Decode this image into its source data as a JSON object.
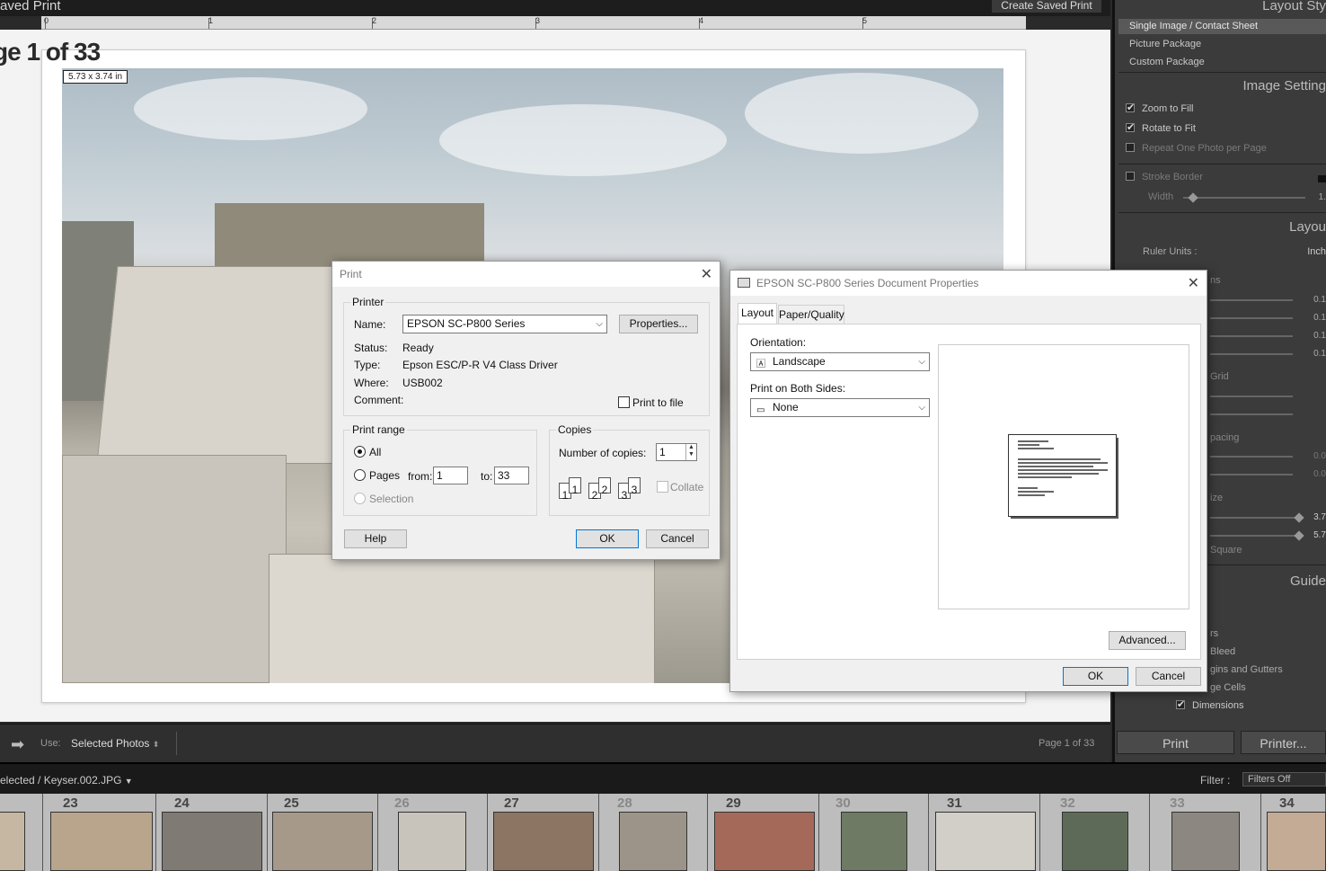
{
  "topbar": {
    "title": "aved Print",
    "create_button": "Create Saved Print"
  },
  "ruler": {
    "marks": [
      "0",
      "1",
      "2",
      "3",
      "4",
      "5"
    ]
  },
  "canvas": {
    "page_label": "ge 1 of 33",
    "dims_tag": "5.73 x 3.74 in"
  },
  "right_panel": {
    "layout_style_head": "Layout Sty",
    "layout_styles": [
      "Single Image / Contact Sheet",
      "Picture Package",
      "Custom Package"
    ],
    "image_settings_head": "Image Setting",
    "zoom_to_fill": "Zoom to Fill",
    "rotate_to_fit": "Rotate to Fit",
    "repeat_one": "Repeat One Photo per Page",
    "stroke_border": "Stroke Border",
    "width": "Width",
    "width_val": "1.",
    "layout_head": "Layou",
    "ruler_units": "Ruler Units :",
    "ruler_units_val": "Inch",
    "margins_frag": "ns",
    "margin_vals": [
      "0.1",
      "0.1",
      "0.1",
      "0.1"
    ],
    "grid_frag": "Grid",
    "spacing_frag": "pacing",
    "spacing_vals": [
      "0.0",
      "0.0"
    ],
    "size_frag": "ize",
    "size_vals": [
      "3.7",
      "5.7"
    ],
    "square_frag": "Square",
    "guides_head": "Guide",
    "guide_items": [
      "rs",
      "Bleed",
      "gins and Gutters",
      "ge Cells",
      "Dimensions"
    ]
  },
  "toolbar": {
    "use_label": "Use:",
    "use_value": "Selected Photos",
    "page_info": "Page 1 of 33",
    "print_button": "Print",
    "printer_button": "Printer..."
  },
  "filmstrip": {
    "path": "elected / Keyser.002.JPG",
    "filter_label": "Filter :",
    "filter_value": "Filters Off",
    "numbers": [
      "",
      "23",
      "24",
      "25",
      "26",
      "27",
      "28",
      "29",
      "30",
      "31",
      "32",
      "33",
      "34"
    ]
  },
  "print_dialog": {
    "title": "Print",
    "printer_group": "Printer",
    "name_label": "Name:",
    "name_value": "EPSON SC-P800 Series",
    "properties_button": "Properties...",
    "status_label": "Status:",
    "status_value": "Ready",
    "type_label": "Type:",
    "type_value": "Epson ESC/P-R V4 Class Driver",
    "where_label": "Where:",
    "where_value": "USB002",
    "comment_label": "Comment:",
    "print_to_file": "Print to file",
    "range_group": "Print range",
    "all_label": "All",
    "pages_label": "Pages",
    "from_label": "from:",
    "from_value": "1",
    "to_label": "to:",
    "to_value": "33",
    "selection_label": "Selection",
    "copies_group": "Copies",
    "num_copies_label": "Number of copies:",
    "num_copies_value": "1",
    "collate_label": "Collate",
    "help_button": "Help",
    "ok_button": "OK",
    "cancel_button": "Cancel"
  },
  "props_dialog": {
    "title": "EPSON SC-P800 Series Document Properties",
    "tab_layout": "Layout",
    "tab_paper": "Paper/Quality",
    "orientation_label": "Orientation:",
    "orientation_value": "Landscape",
    "both_sides_label": "Print on Both Sides:",
    "both_sides_value": "None",
    "advanced_button": "Advanced...",
    "ok_button": "OK",
    "cancel_button": "Cancel"
  }
}
